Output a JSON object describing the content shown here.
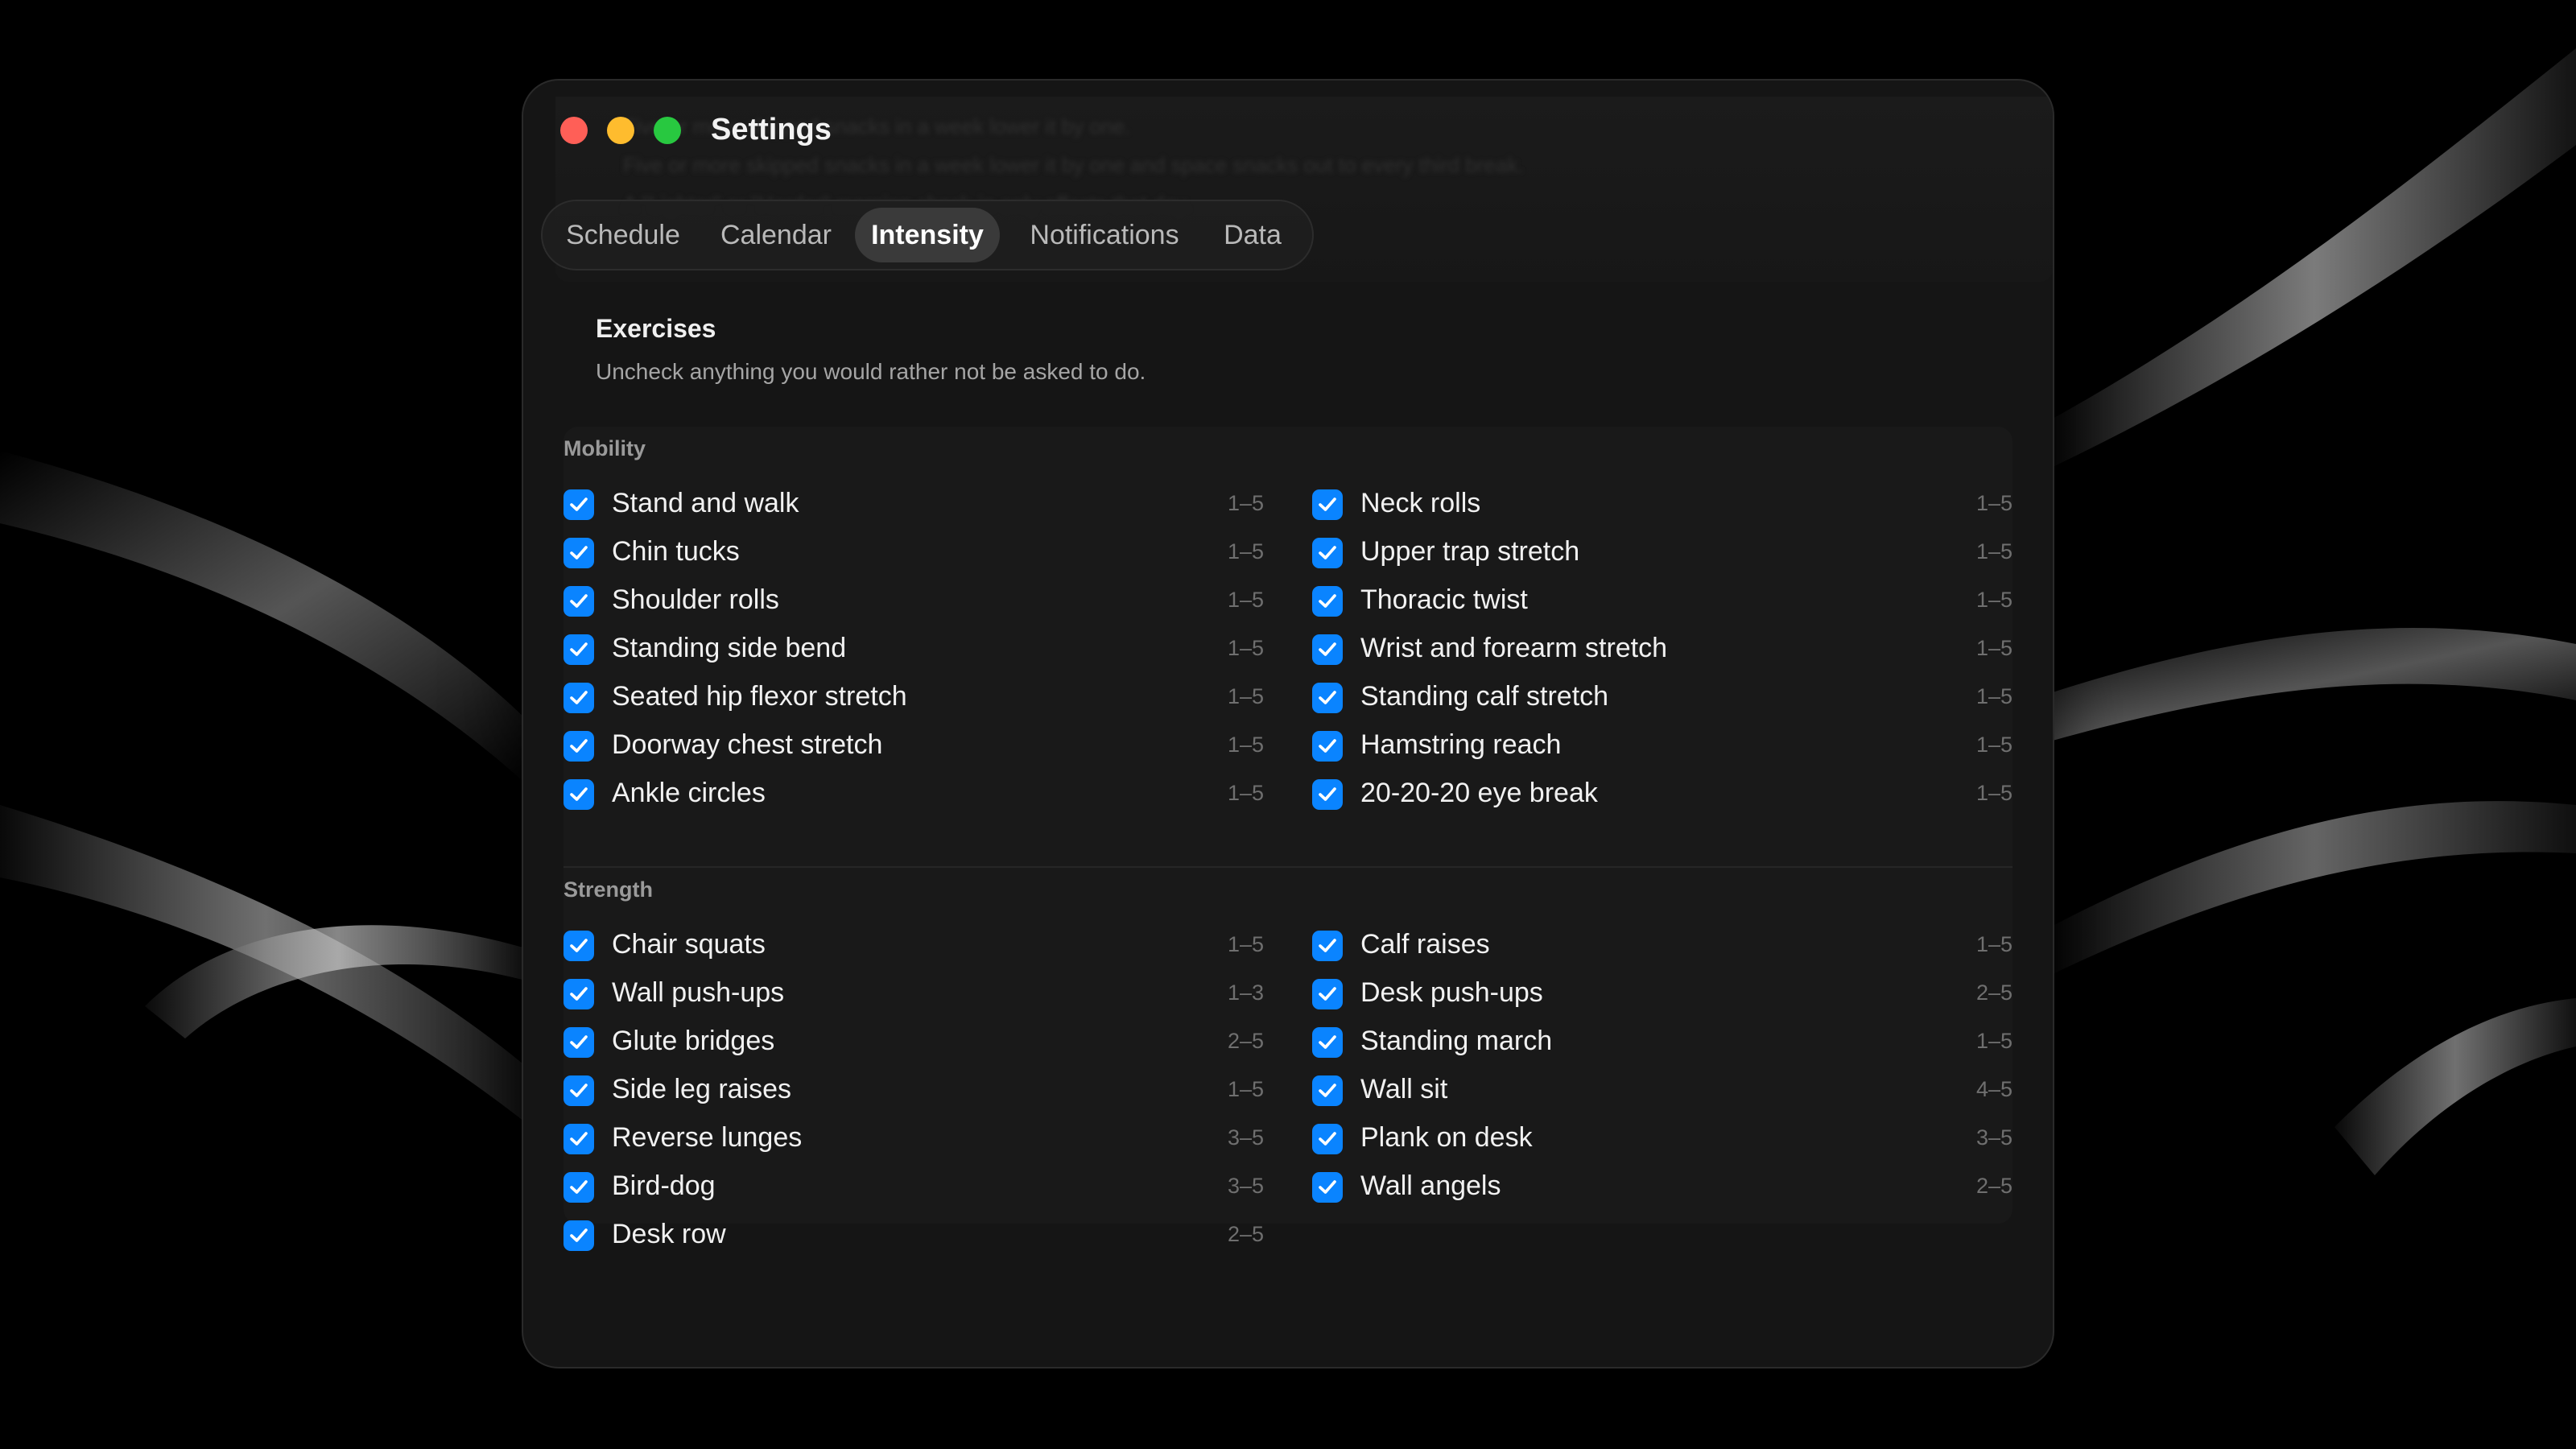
{
  "window": {
    "title": "Settings"
  },
  "tabs": [
    {
      "label": "Schedule",
      "active": false
    },
    {
      "label": "Calendar",
      "active": false
    },
    {
      "label": "Intensity",
      "active": true
    },
    {
      "label": "Notifications",
      "active": false
    },
    {
      "label": "Data",
      "active": false
    }
  ],
  "background_text": [
    "Five or more skipped snacks in a week lower it by one.",
    "Five or more skipped snacks in a week lower it by one and space snacks out to every third break.",
    "A \"Lighter\" or \"Harder\" morning check-in only affects that day."
  ],
  "exercises": {
    "title": "Exercises",
    "description": "Uncheck anything you would rather not be asked to do.",
    "groups": [
      {
        "name": "Mobility",
        "left": [
          {
            "label": "Stand and walk",
            "range": "1–5",
            "checked": true
          },
          {
            "label": "Chin tucks",
            "range": "1–5",
            "checked": true
          },
          {
            "label": "Shoulder rolls",
            "range": "1–5",
            "checked": true
          },
          {
            "label": "Standing side bend",
            "range": "1–5",
            "checked": true
          },
          {
            "label": "Seated hip flexor stretch",
            "range": "1–5",
            "checked": true
          },
          {
            "label": "Doorway chest stretch",
            "range": "1–5",
            "checked": true
          },
          {
            "label": "Ankle circles",
            "range": "1–5",
            "checked": true
          }
        ],
        "right": [
          {
            "label": "Neck rolls",
            "range": "1–5",
            "checked": true
          },
          {
            "label": "Upper trap stretch",
            "range": "1–5",
            "checked": true
          },
          {
            "label": "Thoracic twist",
            "range": "1–5",
            "checked": true
          },
          {
            "label": "Wrist and forearm stretch",
            "range": "1–5",
            "checked": true
          },
          {
            "label": "Standing calf stretch",
            "range": "1–5",
            "checked": true
          },
          {
            "label": "Hamstring reach",
            "range": "1–5",
            "checked": true
          },
          {
            "label": "20-20-20 eye break",
            "range": "1–5",
            "checked": true
          }
        ]
      },
      {
        "name": "Strength",
        "left": [
          {
            "label": "Chair squats",
            "range": "1–5",
            "checked": true
          },
          {
            "label": "Wall push-ups",
            "range": "1–3",
            "checked": true
          },
          {
            "label": "Glute bridges",
            "range": "2–5",
            "checked": true
          },
          {
            "label": "Side leg raises",
            "range": "1–5",
            "checked": true
          },
          {
            "label": "Reverse lunges",
            "range": "3–5",
            "checked": true
          },
          {
            "label": "Bird-dog",
            "range": "3–5",
            "checked": true
          },
          {
            "label": "Desk row",
            "range": "2–5",
            "checked": true
          }
        ],
        "right": [
          {
            "label": "Calf raises",
            "range": "1–5",
            "checked": true
          },
          {
            "label": "Desk push-ups",
            "range": "2–5",
            "checked": true
          },
          {
            "label": "Standing march",
            "range": "1–5",
            "checked": true
          },
          {
            "label": "Wall sit",
            "range": "4–5",
            "checked": true
          },
          {
            "label": "Plank on desk",
            "range": "3–5",
            "checked": true
          },
          {
            "label": "Wall angels",
            "range": "2–5",
            "checked": true
          }
        ]
      }
    ]
  },
  "colors": {
    "accent": "#0a84ff",
    "close": "#ff5f57",
    "minimize": "#febc2e",
    "maximize": "#28c840"
  }
}
